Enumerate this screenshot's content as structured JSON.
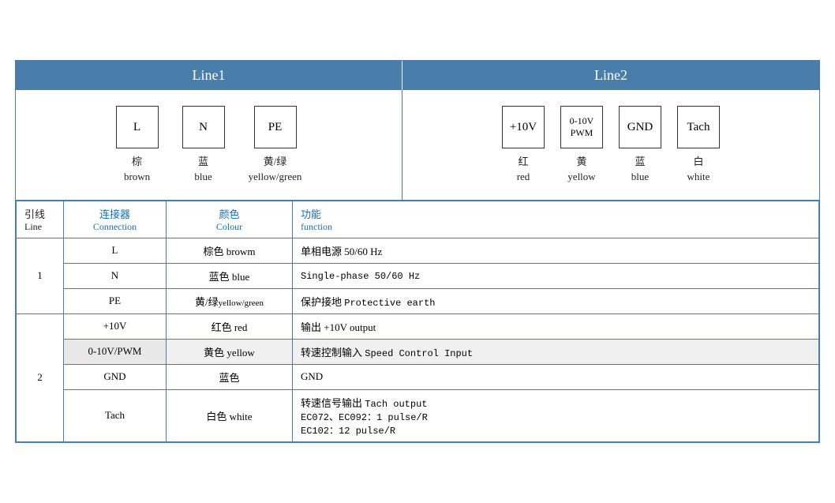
{
  "header": {
    "line1_label": "Line1",
    "line2_label": "Line2"
  },
  "line1_connectors": [
    {
      "symbol": "L",
      "cn": "棕",
      "en": "brown"
    },
    {
      "symbol": "N",
      "cn": "蓝",
      "en": "blue"
    },
    {
      "symbol": "PE",
      "cn": "黄/绿",
      "en": "yellow/green"
    }
  ],
  "line2_connectors": [
    {
      "symbol": "+10V",
      "cn": "红",
      "en": "red"
    },
    {
      "symbol": "0-10V\nPWM",
      "cn": "黄",
      "en": "yellow"
    },
    {
      "symbol": "GND",
      "cn": "蓝",
      "en": "blue"
    },
    {
      "symbol": "Tach",
      "cn": "白",
      "en": "white"
    }
  ],
  "table": {
    "headers": {
      "line_cn": "引线",
      "line_en": "Line",
      "connection_cn": "连接器",
      "connection_en": "Connection",
      "colour_cn": "颜色",
      "colour_en": "Colour",
      "function_cn": "功能",
      "function_en": "function"
    },
    "rows": [
      {
        "line": "1",
        "rowspan": 3,
        "entries": [
          {
            "connection": "L",
            "colour_cn": "棕色",
            "colour_en": "browm",
            "function_cn": "单相电源 50/60 Hz",
            "function_en": ""
          },
          {
            "connection": "N",
            "colour_cn": "蓝色",
            "colour_en": "blue",
            "function_cn": "",
            "function_en": "Single-phase 50/60 Hz"
          },
          {
            "connection": "PE",
            "colour_cn": "黄/绿",
            "colour_en_small": "yellow/green",
            "function_cn": "保护接地",
            "function_en": "Protective earth"
          }
        ]
      },
      {
        "line": "2",
        "rowspan": 4,
        "entries": [
          {
            "connection": "+10V",
            "colour_cn": "红色",
            "colour_en": "red",
            "function_cn": "输出 +10V output",
            "function_en": ""
          },
          {
            "connection": "0-10V/PWM",
            "colour_cn": "黄色",
            "colour_en": "yellow",
            "function_cn": "转速控制输入",
            "function_en": "Speed Control Input",
            "grey": true
          },
          {
            "connection": "GND",
            "colour_cn": "蓝色",
            "colour_en": "",
            "function_cn": "GND",
            "function_en": ""
          },
          {
            "connection": "Tach",
            "colour_cn": "白色",
            "colour_en": "white",
            "function_cn_multi": [
              "转速信号输出 Tach output",
              "EC072、EC092：1 pulse/R",
              "EC102：12 pulse/R"
            ],
            "function_en": ""
          }
        ]
      }
    ]
  }
}
